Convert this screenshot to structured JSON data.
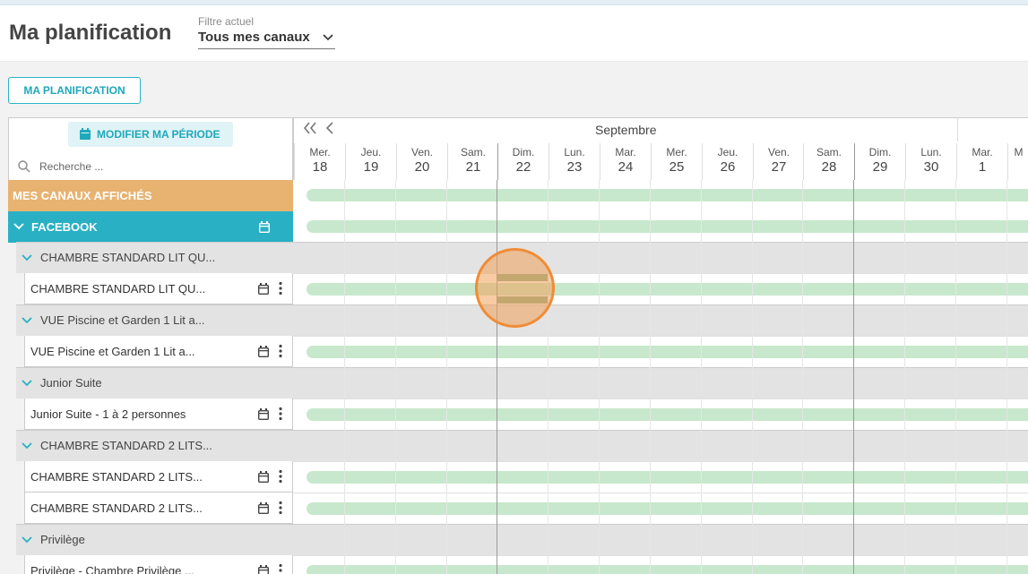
{
  "header": {
    "title": "Ma planification",
    "filter_caption": "Filtre actuel",
    "filter_value": "Tous mes canaux"
  },
  "buttons": {
    "my_planning": "MA PLANIFICATION",
    "modify_period": "MODIFIER MA PÉRIODE"
  },
  "search": {
    "placeholder": "Recherche ..."
  },
  "timeline": {
    "month": "Septembre",
    "days": [
      {
        "name": "Mer.",
        "num": "18"
      },
      {
        "name": "Jeu.",
        "num": "19"
      },
      {
        "name": "Ven.",
        "num": "20"
      },
      {
        "name": "Sam.",
        "num": "21"
      },
      {
        "name": "Dim.",
        "num": "22"
      },
      {
        "name": "Lun.",
        "num": "23"
      },
      {
        "name": "Mar.",
        "num": "24"
      },
      {
        "name": "Mer.",
        "num": "25"
      },
      {
        "name": "Jeu.",
        "num": "26"
      },
      {
        "name": "Ven.",
        "num": "27"
      },
      {
        "name": "Sam.",
        "num": "28"
      },
      {
        "name": "Dim.",
        "num": "29"
      },
      {
        "name": "Lun.",
        "num": "30"
      },
      {
        "name": "Mar.",
        "num": "1"
      },
      {
        "name": "M",
        "num": ""
      }
    ]
  },
  "rows": {
    "all_channels": "MES CANAUX AFFICHÉS",
    "facebook": "FACEBOOK",
    "group1": "CHAMBRE STANDARD LIT QU...",
    "room1": "CHAMBRE STANDARD LIT QU...",
    "group2": "VUE Piscine et Garden 1 Lit a...",
    "room2": "VUE Piscine et Garden 1 Lit a...",
    "group3": "Junior Suite",
    "room3": "Junior Suite - 1 à 2 personnes",
    "group4": "CHAMBRE STANDARD 2 LITS...",
    "room4a": "CHAMBRE STANDARD 2 LITS...",
    "room4b": "CHAMBRE STANDARD 2 LITS...",
    "group5": "Privilège",
    "room5": "Privilège - Chambre Privilège ..."
  },
  "colors": {
    "accent": "#29b0c4",
    "channels_row": "#e8b270",
    "availability_bar": "#c7e8cc",
    "highlight": "#f08c35"
  }
}
